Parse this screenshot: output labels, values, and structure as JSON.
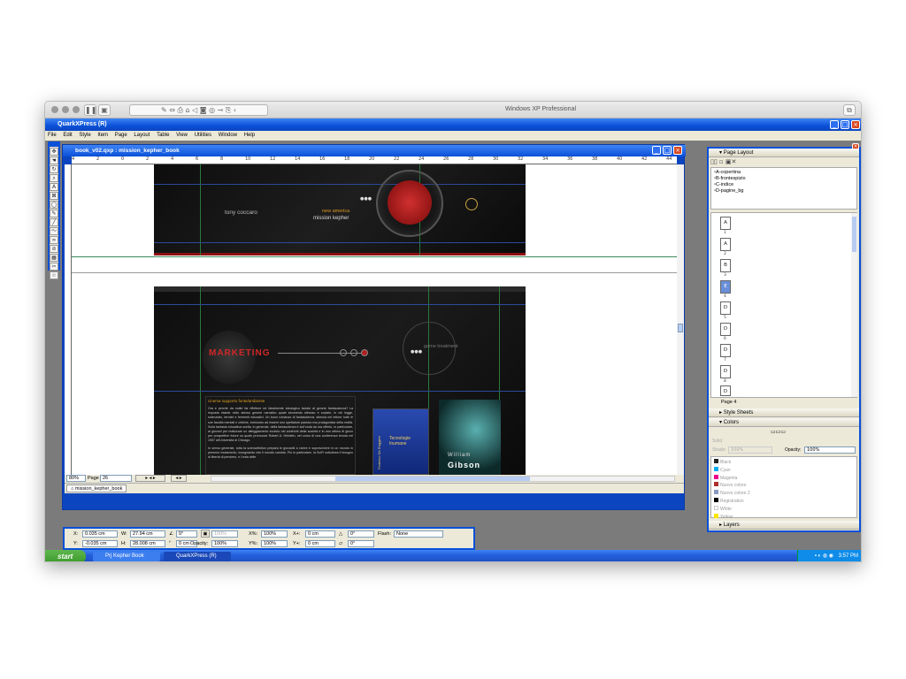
{
  "mac": {
    "title": "Windows XP Professional"
  },
  "app": {
    "title": "QuarkXPress (R)",
    "menu": [
      "File",
      "Edit",
      "Style",
      "Item",
      "Page",
      "Layout",
      "Table",
      "View",
      "Utilities",
      "Window",
      "Help"
    ]
  },
  "doc": {
    "title": "book_v02.qxp : mission_kepher_book",
    "ruler_ticks": [
      "4",
      "2",
      "0",
      "2",
      "4",
      "6",
      "8",
      "10",
      "12",
      "14",
      "16",
      "18",
      "20",
      "22",
      "24",
      "26",
      "28",
      "30",
      "32",
      "34",
      "36",
      "38",
      "40",
      "42",
      "44"
    ],
    "zoom": "80%",
    "page_label": "Page",
    "page_value": "26",
    "layout_tab": "mission_kepher_book"
  },
  "top_spread": {
    "author": "tony coccaro",
    "subtitle_orange": "new america",
    "subtitle_white": "mission kepher",
    "dots": "●●●"
  },
  "bottom_spread": {
    "heading": "MARKETING",
    "game_label": "game treatment",
    "dots": "●●●",
    "body_heading": "cinema supporto fonte/ambiente",
    "body_par1": "Ora e perchè da molte far riflettere ed idealmente ideologico isolato al genere fantascienza? La risposta risiede nello stesso genere narrativo quale strumento stimoso e sociale, in chi legge, scienziato, termini e fermenti educativi. Un buon romanzo di fantascienza, stimola nel lettore tutte le sue facoltà mentali e critiche, inchiostro ad essere uno spettatore passivo ma protagonista della realtà. Sulla fantasia educativa scelta, in generale, della fantascienza è sull'onda da ora offerto, in particolare, ai giovani per realizzare un atteggiamento evoluto nei confronti della società e in uno ottimo di gioco per prospettive future su quale promuove Robert A. Heinlein, nel corso di una conferenza tenuta nel 1957 all'Università di Chicago.",
    "body_par2": "In senso generale, tutta la sciencefiction prepara le giovanili a vivere e sopravvivere in un mondo in perenne mutamento, insegnando che il mondo cambia. Più in particolare, la SciFi sottolinea il bisogno di libertà di pensiero, e l'onta delle",
    "book1_title": "Tecnologie Inumane",
    "book1_author": "Federico De Ruggieri",
    "book2_first": "William",
    "book2_last": "Gibson"
  },
  "panels": {
    "page_layout": {
      "title": "Page Layout",
      "masters": [
        "A-copertina",
        "B-frontespizio",
        "C-indice",
        "D-pagine_bg"
      ],
      "pages": [
        {
          "label": "A",
          "num": "1"
        },
        {
          "label": "A",
          "num": "2"
        },
        {
          "label": "B",
          "num": "3"
        },
        {
          "label": "E",
          "num": "4"
        },
        {
          "label": "D",
          "num": "5"
        },
        {
          "label": "D",
          "num": "6"
        },
        {
          "label": "D",
          "num": "7"
        },
        {
          "label": "D",
          "num": "8"
        },
        {
          "label": "D",
          "num": "9"
        }
      ],
      "status": "Page 4"
    },
    "style_sheets": {
      "title": "Style Sheets"
    },
    "colors": {
      "title": "Colors",
      "solid": "Solid",
      "shade_label": "Shade:",
      "shade_value": "100%",
      "opacity_label": "Opacity:",
      "opacity_value": "100%",
      "items": [
        {
          "name": "Black",
          "color": "#222222"
        },
        {
          "name": "Cyan",
          "color": "#00aeef"
        },
        {
          "name": "Magenta",
          "color": "#ec008c"
        },
        {
          "name": "Nuovo colore",
          "color": "#b03030"
        },
        {
          "name": "Nuovo colore 2",
          "color": "#8a9ac0"
        },
        {
          "name": "Registration",
          "color": "#000000"
        },
        {
          "name": "White",
          "color": "#ffffff"
        },
        {
          "name": "Yellow",
          "color": "#ffe600"
        }
      ]
    },
    "layers": {
      "title": "Layers"
    }
  },
  "measure": {
    "x_label": "X:",
    "x_value": "0.035 cm",
    "y_label": "Y:",
    "y_value": "-0.035 cm",
    "w_label": "W:",
    "w_value": "27.94 cm",
    "h_label": "H:",
    "h_value": "28.008 cm",
    "angle_value": "0°",
    "corner_value": "0 cm",
    "shade_value": "100%",
    "opacity_label": "Opacity:",
    "opacity_value": "100%",
    "xpct_label": "X%:",
    "xpct_value": "100%",
    "ypct_label": "Y%:",
    "ypct_value": "100%",
    "xplus_label": "X+:",
    "xplus_value": "0 cm",
    "yplus_label": "Y+:",
    "yplus_value": "0 cm",
    "rot1_value": "0°",
    "rot2_value": "0°",
    "flash_label": "Flash:",
    "flash_value": "None"
  },
  "taskbar": {
    "start": "start",
    "tasks": [
      "Prj Kepher Book",
      "QuarkXPress (R)"
    ],
    "clock": "3:57 PM"
  }
}
